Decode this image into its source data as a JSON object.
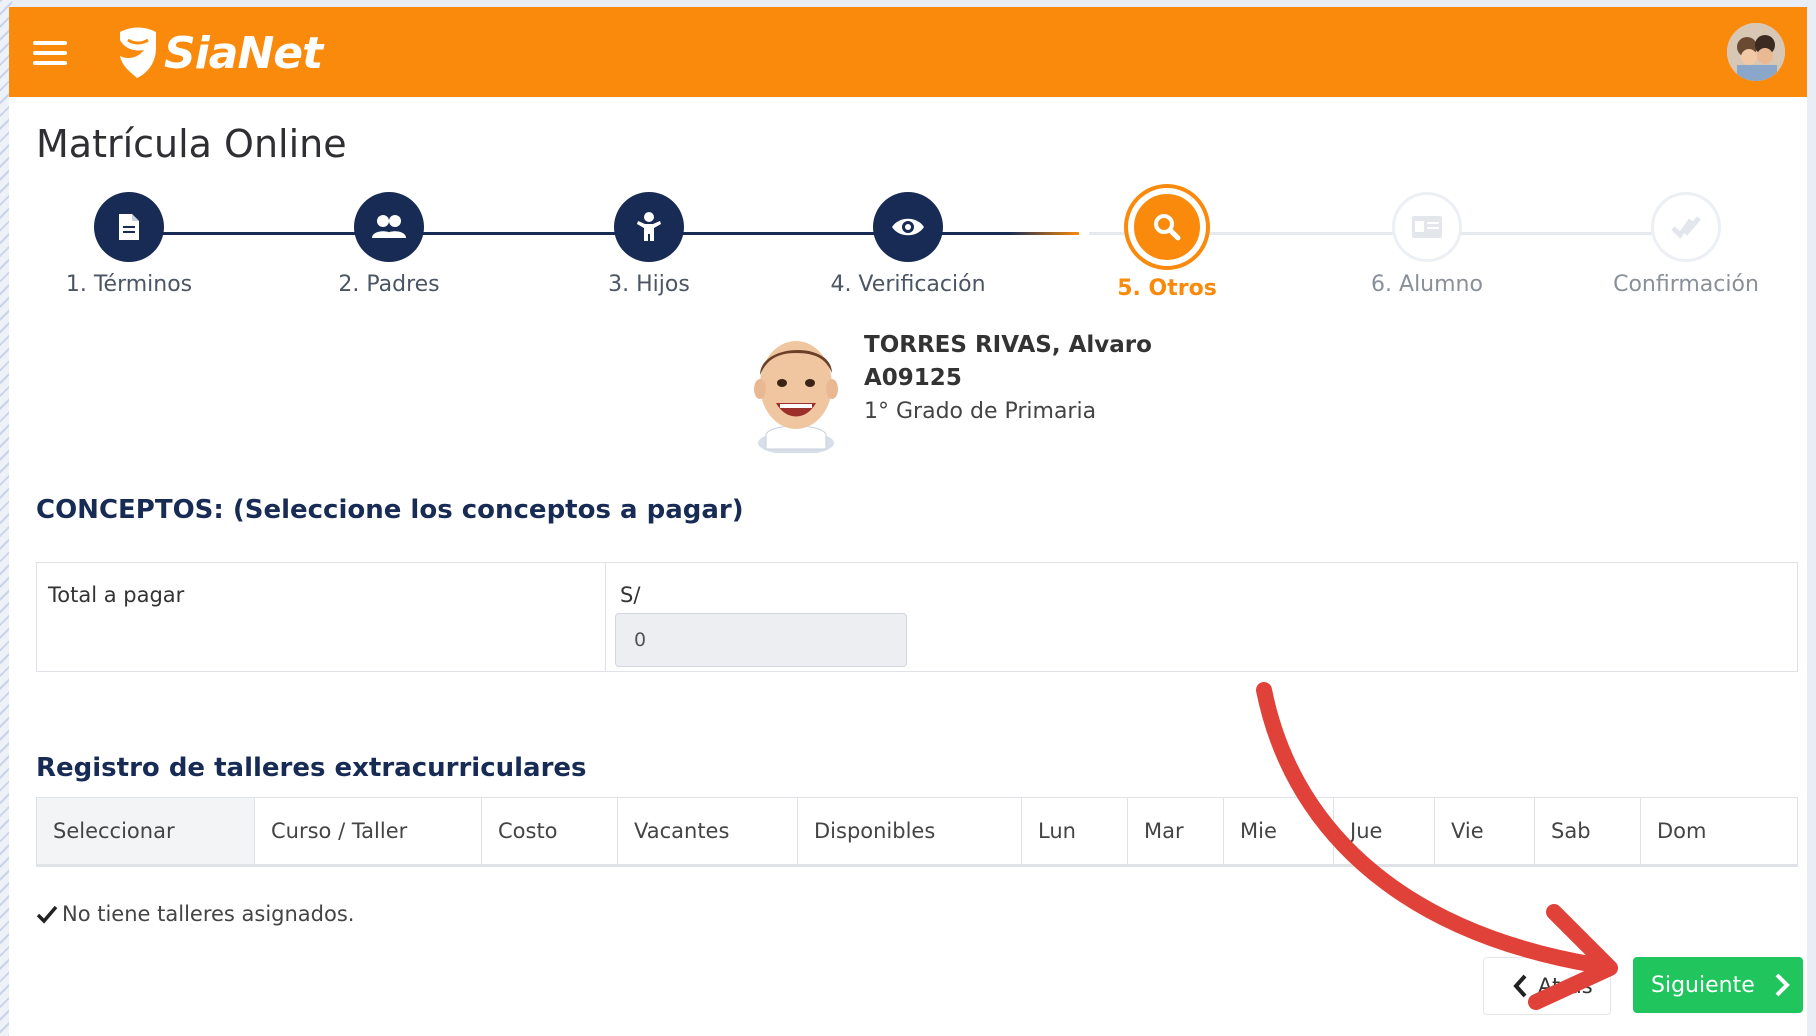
{
  "app": {
    "brand": "SiaNet",
    "accent_color": "#fa8a0b",
    "navy_color": "#172b55",
    "success_color": "#21c55d"
  },
  "page": {
    "title": "Matrícula Online"
  },
  "stepper": [
    {
      "label": "1. Términos",
      "state": "done",
      "icon": "document-icon"
    },
    {
      "label": "2. Padres",
      "state": "done",
      "icon": "users-icon"
    },
    {
      "label": "3. Hijos",
      "state": "done",
      "icon": "child-icon"
    },
    {
      "label": "4. Verificación",
      "state": "done",
      "icon": "eye-icon"
    },
    {
      "label": "5. Otros",
      "state": "active",
      "icon": "search-icon"
    },
    {
      "label": "6. Alumno",
      "state": "pending",
      "icon": "id-card-icon"
    },
    {
      "label": "Confirmación",
      "state": "pending",
      "icon": "check-icon"
    }
  ],
  "student": {
    "name": "TORRES RIVAS, Alvaro",
    "code": "A09125",
    "grade": "1° Grado de Primaria"
  },
  "concepts": {
    "title": "CONCEPTOS: (Seleccione los conceptos a pagar)",
    "total_label": "Total a pagar",
    "currency": "S/",
    "amount_value": "0"
  },
  "talleres": {
    "title": "Registro de talleres extracurriculares",
    "columns": [
      "Seleccionar",
      "Curso / Taller",
      "Costo",
      "Vacantes",
      "Disponibles",
      "Lun",
      "Mar",
      "Mie",
      "Jue",
      "Vie",
      "Sab",
      "Dom"
    ],
    "empty_message": "No tiene talleres asignados."
  },
  "buttons": {
    "prev_label": "Atrás",
    "next_label": "Siguiente"
  }
}
